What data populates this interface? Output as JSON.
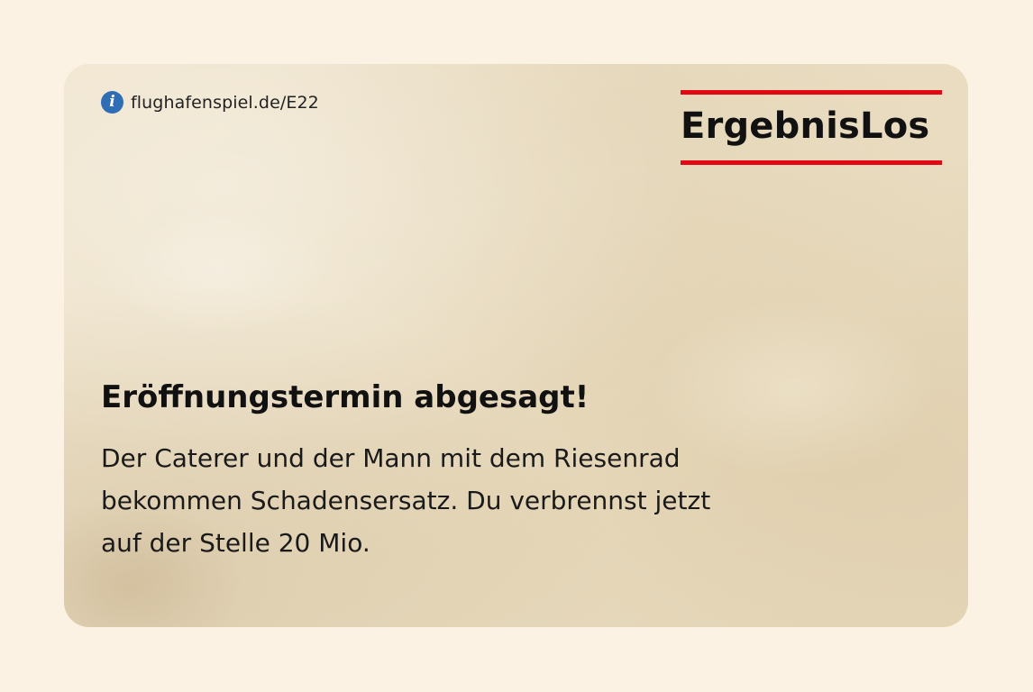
{
  "info": {
    "icon": "info-icon",
    "icon_glyph": "i",
    "link_text": "flughafenspiel.de/E22"
  },
  "brand": {
    "name": "ErgebnisLos",
    "accent_color": "#e30613"
  },
  "card": {
    "headline": "Eröffnungstermin abgesagt!",
    "body_lines": [
      "Der Caterer und der Mann mit dem Riesenrad",
      "bekommen Schadensersatz. Du verbrennst jetzt",
      "auf der Stelle 20 Mio."
    ]
  },
  "colors": {
    "page_background": "#fbf2e3",
    "card_paper": "#ece0c6",
    "info_icon": "#2f6db5",
    "text": "#111111"
  }
}
